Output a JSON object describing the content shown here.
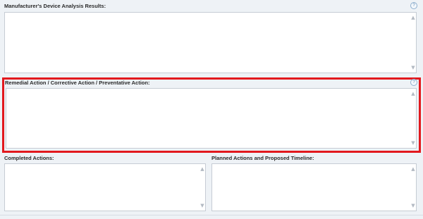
{
  "sections": {
    "device_analysis": {
      "label": "Manufacturer's Device Analysis Results:",
      "value": "",
      "help_icon": "help-circle-icon"
    },
    "remedial_action": {
      "label": "Remedial Action / Corrective Action / Preventative Action:",
      "value": "",
      "help_icon": "help-circle-icon",
      "highlight_color": "#e2191e"
    },
    "completed_actions": {
      "label": "Completed Actions:",
      "value": ""
    },
    "planned_actions": {
      "label": "Planned Actions and Proposed Timeline:",
      "value": ""
    }
  },
  "glyphs": {
    "help": "?",
    "scroll_up": "▲",
    "scroll_down": "▼"
  },
  "colors": {
    "background": "#eef2f6",
    "field_border": "#c6ccd4",
    "highlight": "#e2191e"
  }
}
